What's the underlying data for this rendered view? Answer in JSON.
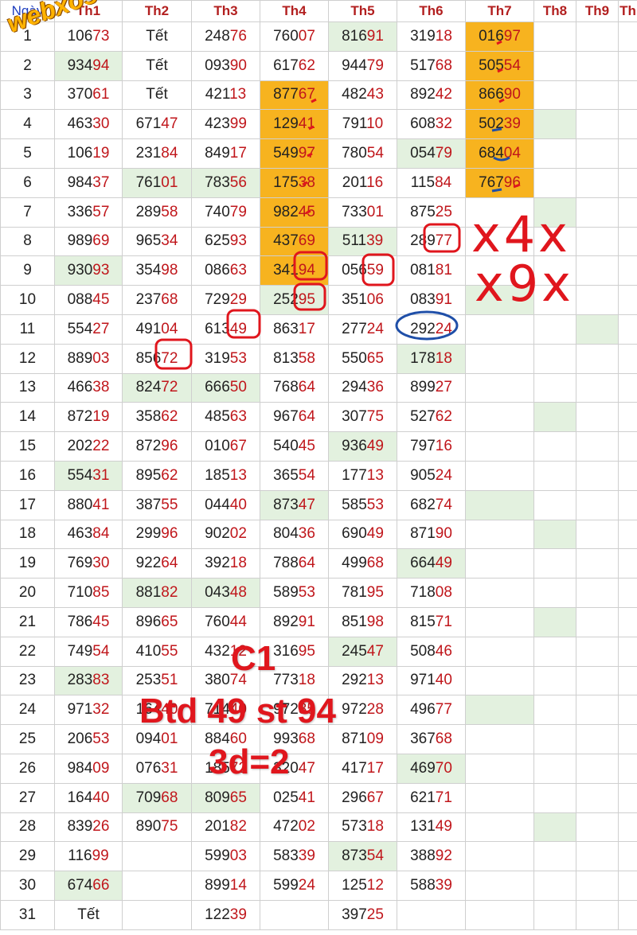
{
  "header": [
    "Ngày",
    "Th1",
    "Th2",
    "Th3",
    "Th4",
    "Th5",
    "Th6",
    "Th7",
    "Th8",
    "Th9",
    "Th"
  ],
  "watermark": "webxoso.net",
  "notes": {
    "line1": "C1",
    "line2": "Btd 49 st 94",
    "line3": "3d=2",
    "hand1": "x4x",
    "hand2": "x9x"
  },
  "colors": {
    "highlight_orange": "#f7b31f",
    "highlight_green": "#e3f1df",
    "accent_red": "#e0161d",
    "pen_blue": "#1f4fa8"
  },
  "rows": [
    {
      "day": "1",
      "cells": [
        {
          "p": "106",
          "s": "73"
        },
        {
          "t": "Tết"
        },
        {
          "p": "248",
          "s": "76"
        },
        {
          "p": "760",
          "s": "07"
        },
        {
          "p": "816",
          "s": "91",
          "g": 1
        },
        {
          "p": "319",
          "s": "18"
        },
        {
          "p": "016",
          "s": "97",
          "o": 1
        },
        {},
        {}
      ]
    },
    {
      "day": "2",
      "cells": [
        {
          "p": "934",
          "s": "94",
          "g": 1
        },
        {
          "t": "Tết"
        },
        {
          "p": "093",
          "s": "90"
        },
        {
          "p": "617",
          "s": "62"
        },
        {
          "p": "944",
          "s": "79"
        },
        {
          "p": "517",
          "s": "68"
        },
        {
          "p": "505",
          "s": "54",
          "o": 1
        },
        {},
        {}
      ]
    },
    {
      "day": "3",
      "cells": [
        {
          "p": "370",
          "s": "61"
        },
        {
          "t": "Tết"
        },
        {
          "p": "421",
          "s": "13"
        },
        {
          "p": "877",
          "s": "67",
          "o": 1
        },
        {
          "p": "482",
          "s": "43"
        },
        {
          "p": "892",
          "s": "42"
        },
        {
          "p": "866",
          "s": "90",
          "o": 1
        },
        {},
        {}
      ]
    },
    {
      "day": "4",
      "cells": [
        {
          "p": "463",
          "s": "30"
        },
        {
          "p": "671",
          "s": "47"
        },
        {
          "p": "423",
          "s": "99"
        },
        {
          "p": "129",
          "s": "41",
          "o": 1
        },
        {
          "p": "791",
          "s": "10"
        },
        {
          "p": "608",
          "s": "32"
        },
        {
          "p": "502",
          "s": "39",
          "o": 1
        },
        {
          "g": 1
        },
        {}
      ]
    },
    {
      "day": "5",
      "cells": [
        {
          "p": "106",
          "s": "19"
        },
        {
          "p": "231",
          "s": "84"
        },
        {
          "p": "849",
          "s": "17"
        },
        {
          "p": "549",
          "s": "97",
          "o": 1
        },
        {
          "p": "780",
          "s": "54"
        },
        {
          "p": "054",
          "s": "79",
          "g": 1
        },
        {
          "p": "684",
          "s": "04",
          "o": 1
        },
        {},
        {}
      ]
    },
    {
      "day": "6",
      "cells": [
        {
          "p": "984",
          "s": "37"
        },
        {
          "p": "761",
          "s": "01",
          "g": 1
        },
        {
          "p": "783",
          "s": "56",
          "g": 1
        },
        {
          "p": "175",
          "s": "38",
          "o": 1
        },
        {
          "p": "201",
          "s": "16"
        },
        {
          "p": "115",
          "s": "84"
        },
        {
          "p": "767",
          "s": "96",
          "o": 1
        },
        {},
        {}
      ]
    },
    {
      "day": "7",
      "cells": [
        {
          "p": "336",
          "s": "57"
        },
        {
          "p": "289",
          "s": "58"
        },
        {
          "p": "740",
          "s": "79"
        },
        {
          "p": "982",
          "s": "45",
          "o": 1
        },
        {
          "p": "733",
          "s": "01"
        },
        {
          "p": "875",
          "s": "25"
        },
        {},
        {
          "g": 1
        },
        {}
      ]
    },
    {
      "day": "8",
      "cells": [
        {
          "p": "989",
          "s": "69"
        },
        {
          "p": "965",
          "s": "34"
        },
        {
          "p": "625",
          "s": "93"
        },
        {
          "p": "437",
          "s": "69",
          "o": 1
        },
        {
          "p": "511",
          "s": "39",
          "g": 1
        },
        {
          "p": "289",
          "s": "77"
        },
        {},
        {},
        {}
      ]
    },
    {
      "day": "9",
      "cells": [
        {
          "p": "930",
          "s": "93",
          "g": 1
        },
        {
          "p": "354",
          "s": "98"
        },
        {
          "p": "086",
          "s": "63"
        },
        {
          "p": "341",
          "s": "94",
          "o": 1
        },
        {
          "p": "056",
          "s": "59"
        },
        {
          "p": "081",
          "s": "81"
        },
        {},
        {},
        {}
      ]
    },
    {
      "day": "10",
      "cells": [
        {
          "p": "088",
          "s": "45"
        },
        {
          "p": "237",
          "s": "68"
        },
        {
          "p": "729",
          "s": "29"
        },
        {
          "p": "252",
          "s": "95",
          "g": 1
        },
        {
          "p": "351",
          "s": "06"
        },
        {
          "p": "083",
          "s": "91"
        },
        {
          "g": 1
        },
        {},
        {}
      ]
    },
    {
      "day": "11",
      "cells": [
        {
          "p": "554",
          "s": "27"
        },
        {
          "p": "491",
          "s": "04"
        },
        {
          "p": "613",
          "s": "49"
        },
        {
          "p": "863",
          "s": "17"
        },
        {
          "p": "277",
          "s": "24"
        },
        {
          "p": "292",
          "s": "24"
        },
        {},
        {},
        {
          "g": 1
        }
      ]
    },
    {
      "day": "12",
      "cells": [
        {
          "p": "889",
          "s": "03"
        },
        {
          "p": "856",
          "s": "72"
        },
        {
          "p": "319",
          "s": "53"
        },
        {
          "p": "813",
          "s": "58"
        },
        {
          "p": "550",
          "s": "65"
        },
        {
          "p": "178",
          "s": "18",
          "g": 1
        },
        {},
        {},
        {}
      ]
    },
    {
      "day": "13",
      "cells": [
        {
          "p": "466",
          "s": "38"
        },
        {
          "p": "824",
          "s": "72",
          "g": 1
        },
        {
          "p": "666",
          "s": "50",
          "g": 1
        },
        {
          "p": "768",
          "s": "64"
        },
        {
          "p": "294",
          "s": "36"
        },
        {
          "p": "899",
          "s": "27"
        },
        {},
        {},
        {}
      ]
    },
    {
      "day": "14",
      "cells": [
        {
          "p": "872",
          "s": "19"
        },
        {
          "p": "358",
          "s": "62"
        },
        {
          "p": "485",
          "s": "63"
        },
        {
          "p": "967",
          "s": "64"
        },
        {
          "p": "307",
          "s": "75"
        },
        {
          "p": "527",
          "s": "62"
        },
        {},
        {
          "g": 1
        },
        {}
      ]
    },
    {
      "day": "15",
      "cells": [
        {
          "p": "202",
          "s": "22"
        },
        {
          "p": "872",
          "s": "96"
        },
        {
          "p": "010",
          "s": "67"
        },
        {
          "p": "540",
          "s": "45"
        },
        {
          "p": "936",
          "s": "49",
          "g": 1
        },
        {
          "p": "797",
          "s": "16"
        },
        {},
        {},
        {}
      ]
    },
    {
      "day": "16",
      "cells": [
        {
          "p": "554",
          "s": "31",
          "g": 1
        },
        {
          "p": "895",
          "s": "62"
        },
        {
          "p": "185",
          "s": "13"
        },
        {
          "p": "365",
          "s": "54"
        },
        {
          "p": "177",
          "s": "13"
        },
        {
          "p": "905",
          "s": "24"
        },
        {},
        {},
        {}
      ]
    },
    {
      "day": "17",
      "cells": [
        {
          "p": "880",
          "s": "41"
        },
        {
          "p": "387",
          "s": "55"
        },
        {
          "p": "044",
          "s": "40"
        },
        {
          "p": "873",
          "s": "47",
          "g": 1
        },
        {
          "p": "585",
          "s": "53"
        },
        {
          "p": "682",
          "s": "74"
        },
        {
          "g": 1
        },
        {},
        {}
      ]
    },
    {
      "day": "18",
      "cells": [
        {
          "p": "463",
          "s": "84"
        },
        {
          "p": "299",
          "s": "96"
        },
        {
          "p": "902",
          "s": "02"
        },
        {
          "p": "804",
          "s": "36"
        },
        {
          "p": "690",
          "s": "49"
        },
        {
          "p": "871",
          "s": "90"
        },
        {},
        {
          "g": 1
        },
        {}
      ]
    },
    {
      "day": "19",
      "cells": [
        {
          "p": "769",
          "s": "30"
        },
        {
          "p": "922",
          "s": "64"
        },
        {
          "p": "392",
          "s": "18"
        },
        {
          "p": "788",
          "s": "64"
        },
        {
          "p": "499",
          "s": "68"
        },
        {
          "p": "664",
          "s": "49",
          "g": 1
        },
        {},
        {},
        {}
      ]
    },
    {
      "day": "20",
      "cells": [
        {
          "p": "710",
          "s": "85"
        },
        {
          "p": "881",
          "s": "82",
          "g": 1
        },
        {
          "p": "043",
          "s": "48",
          "g": 1
        },
        {
          "p": "589",
          "s": "53"
        },
        {
          "p": "781",
          "s": "95"
        },
        {
          "p": "718",
          "s": "08"
        },
        {},
        {},
        {}
      ]
    },
    {
      "day": "21",
      "cells": [
        {
          "p": "786",
          "s": "45"
        },
        {
          "p": "896",
          "s": "65"
        },
        {
          "p": "760",
          "s": "44"
        },
        {
          "p": "892",
          "s": "91"
        },
        {
          "p": "851",
          "s": "98"
        },
        {
          "p": "815",
          "s": "71"
        },
        {},
        {
          "g": 1
        },
        {}
      ]
    },
    {
      "day": "22",
      "cells": [
        {
          "p": "749",
          "s": "54"
        },
        {
          "p": "410",
          "s": "55"
        },
        {
          "p": "432",
          "s": "12"
        },
        {
          "p": "316",
          "s": "95"
        },
        {
          "p": "245",
          "s": "47",
          "g": 1
        },
        {
          "p": "508",
          "s": "46"
        },
        {},
        {},
        {}
      ]
    },
    {
      "day": "23",
      "cells": [
        {
          "p": "283",
          "s": "83",
          "g": 1
        },
        {
          "p": "253",
          "s": "51"
        },
        {
          "p": "380",
          "s": "74"
        },
        {
          "p": "773",
          "s": "18"
        },
        {
          "p": "292",
          "s": "13"
        },
        {
          "p": "971",
          "s": "40"
        },
        {},
        {},
        {}
      ]
    },
    {
      "day": "24",
      "cells": [
        {
          "p": "971",
          "s": "32"
        },
        {
          "p": "164",
          "s": "40"
        },
        {
          "p": "714",
          "s": "40"
        },
        {
          "p": "972",
          "s": "85"
        },
        {
          "p": "972",
          "s": "28"
        },
        {
          "p": "496",
          "s": "77"
        },
        {
          "g": 1
        },
        {},
        {}
      ]
    },
    {
      "day": "25",
      "cells": [
        {
          "p": "206",
          "s": "53"
        },
        {
          "p": "094",
          "s": "01"
        },
        {
          "p": "884",
          "s": "60"
        },
        {
          "p": "993",
          "s": "68"
        },
        {
          "p": "871",
          "s": "09"
        },
        {
          "p": "367",
          "s": "68"
        },
        {},
        {},
        {}
      ]
    },
    {
      "day": "26",
      "cells": [
        {
          "p": "984",
          "s": "09"
        },
        {
          "p": "076",
          "s": "31"
        },
        {
          "p": "185",
          "s": "72"
        },
        {
          "p": "320",
          "s": "47"
        },
        {
          "p": "417",
          "s": "17"
        },
        {
          "p": "469",
          "s": "70",
          "g": 1
        },
        {},
        {},
        {}
      ]
    },
    {
      "day": "27",
      "cells": [
        {
          "p": "164",
          "s": "40"
        },
        {
          "p": "709",
          "s": "68",
          "g": 1
        },
        {
          "p": "809",
          "s": "65",
          "g": 1
        },
        {
          "p": "025",
          "s": "41"
        },
        {
          "p": "296",
          "s": "67"
        },
        {
          "p": "621",
          "s": "71"
        },
        {},
        {},
        {}
      ]
    },
    {
      "day": "28",
      "cells": [
        {
          "p": "839",
          "s": "26"
        },
        {
          "p": "890",
          "s": "75"
        },
        {
          "p": "201",
          "s": "82"
        },
        {
          "p": "472",
          "s": "02"
        },
        {
          "p": "573",
          "s": "18"
        },
        {
          "p": "131",
          "s": "49"
        },
        {},
        {
          "g": 1
        },
        {}
      ]
    },
    {
      "day": "29",
      "cells": [
        {
          "p": "116",
          "s": "99"
        },
        {},
        {
          "p": "599",
          "s": "03"
        },
        {
          "p": "583",
          "s": "39"
        },
        {
          "p": "873",
          "s": "54",
          "g": 1
        },
        {
          "p": "388",
          "s": "92"
        },
        {},
        {},
        {}
      ]
    },
    {
      "day": "30",
      "cells": [
        {
          "p": "674",
          "s": "66",
          "g": 1
        },
        {},
        {
          "p": "899",
          "s": "14"
        },
        {
          "p": "599",
          "s": "24"
        },
        {
          "p": "125",
          "s": "12"
        },
        {
          "p": "588",
          "s": "39"
        },
        {},
        {},
        {}
      ]
    },
    {
      "day": "31",
      "cells": [
        {
          "t": "Tết"
        },
        {},
        {
          "p": "122",
          "s": "39"
        },
        {},
        {
          "p": "397",
          "s": "25"
        },
        {},
        {},
        {},
        {}
      ]
    }
  ]
}
